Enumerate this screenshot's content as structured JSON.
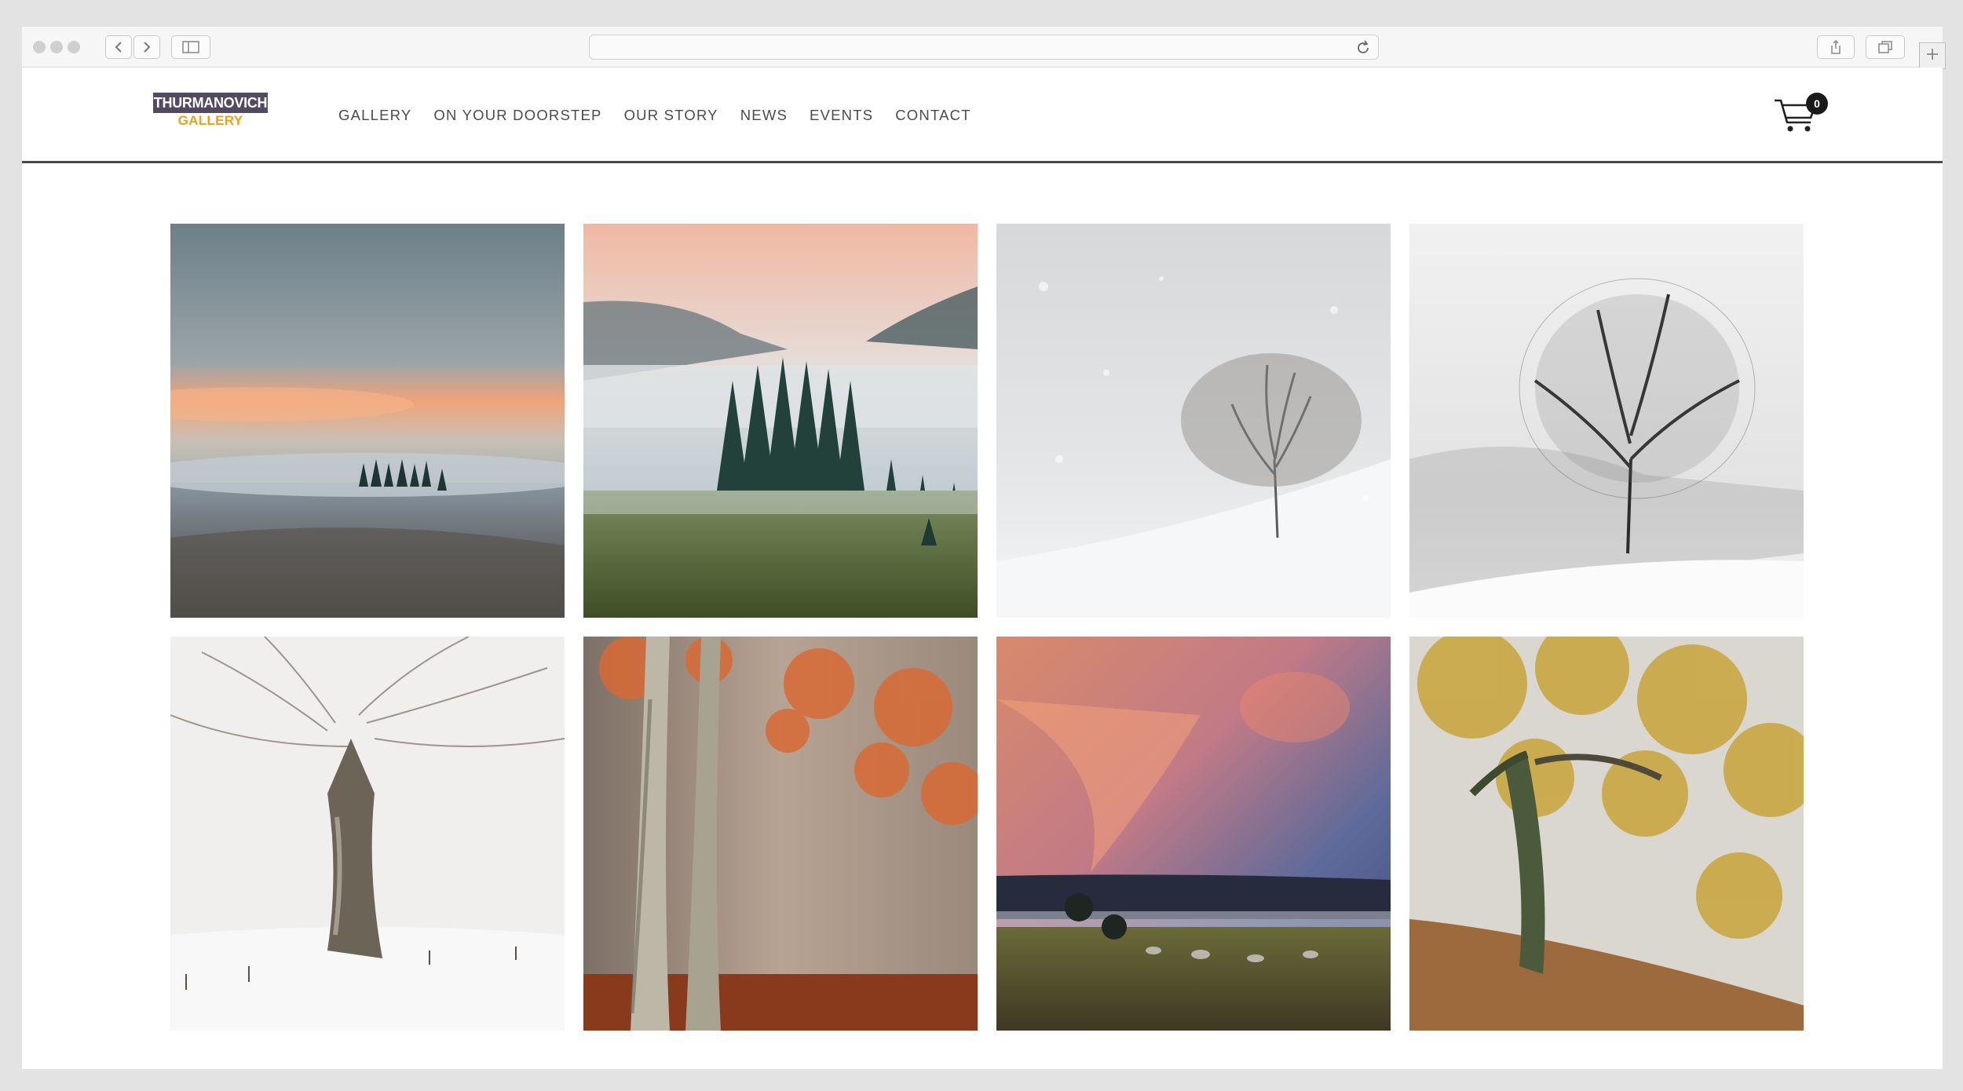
{
  "brand": {
    "line1": "THURMANOVICH",
    "line2": "GALLERY",
    "colors": {
      "band": "#514a60",
      "accent": "#e6a11b"
    }
  },
  "nav": {
    "items": [
      "GALLERY",
      "ON YOUR DOORSTEP",
      "OUR STORY",
      "NEWS",
      "EVENTS",
      "CONTACT"
    ]
  },
  "cart": {
    "icon": "shopping-cart-icon",
    "count": "0"
  },
  "browser": {
    "icons": [
      "back-icon",
      "forward-icon",
      "sidebar-icon",
      "reload-icon",
      "share-icon",
      "tabs-icon",
      "new-tab-icon"
    ]
  },
  "gallery": {
    "images": [
      {
        "subject": "misty valley at sunrise"
      },
      {
        "subject": "foggy pine forest with pink sky"
      },
      {
        "subject": "lone tree in snowfall"
      },
      {
        "subject": "black and white winter tree"
      },
      {
        "subject": "frosted beech tree in snow"
      },
      {
        "subject": "autumn beech trees in fog"
      },
      {
        "subject": "sunset sky over meadow"
      },
      {
        "subject": "autumn oak trees on hillside"
      }
    ]
  }
}
